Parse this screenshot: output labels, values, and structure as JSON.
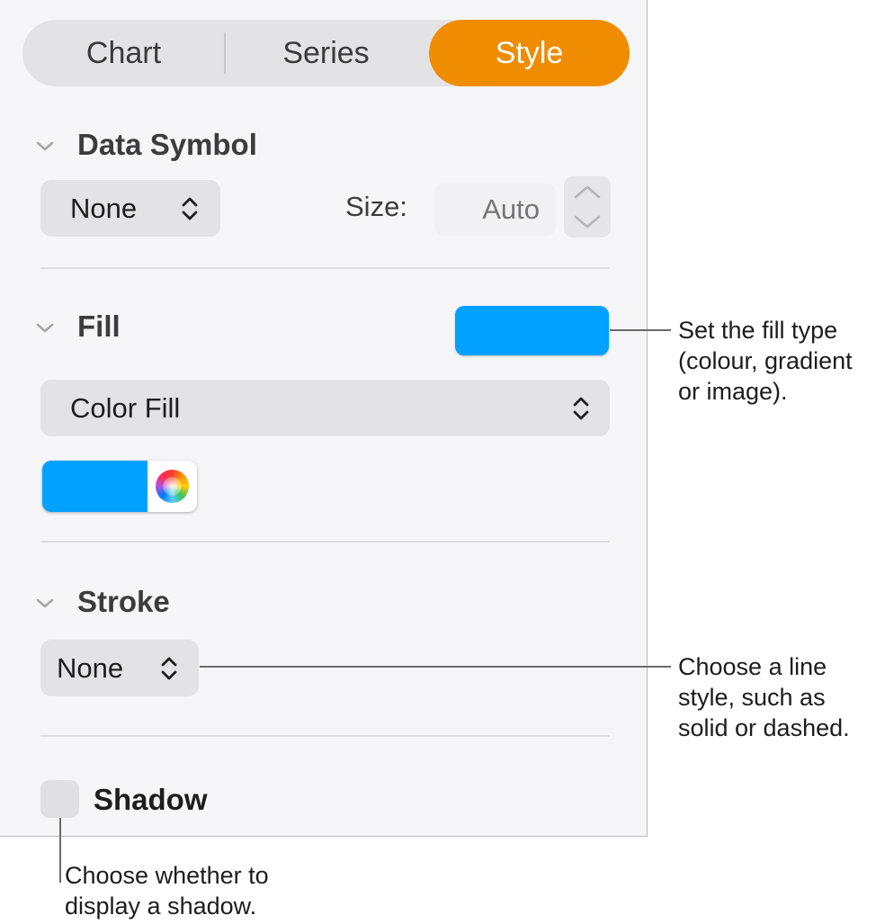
{
  "tabs": {
    "chart": "Chart",
    "series": "Series",
    "style": "Style"
  },
  "data_symbol": {
    "title": "Data Symbol",
    "popup_value": "None",
    "size_label": "Size:",
    "size_placeholder": "Auto"
  },
  "fill": {
    "title": "Fill",
    "type_value": "Color Fill",
    "color": "#03a1ff"
  },
  "stroke": {
    "title": "Stroke",
    "popup_value": "None"
  },
  "shadow": {
    "label": "Shadow",
    "checked": false
  },
  "callouts": {
    "fill_line1": "Set the fill type",
    "fill_line2": "(colour, gradient",
    "fill_line3": "or image).",
    "stroke_line1": "Choose a line",
    "stroke_line2": "style, such as",
    "stroke_line3": "solid or dashed.",
    "shadow_line1": "Choose whether to",
    "shadow_line2": "display a shadow."
  },
  "colors": {
    "accent": "#f08c00",
    "fill_swatch": "#03a1ff"
  },
  "icons": {
    "disclosure": "chevron-down-icon",
    "popup": "up-down-chevrons-icon",
    "stepper": "stepper-icon",
    "color_wheel": "color-wheel-icon"
  }
}
